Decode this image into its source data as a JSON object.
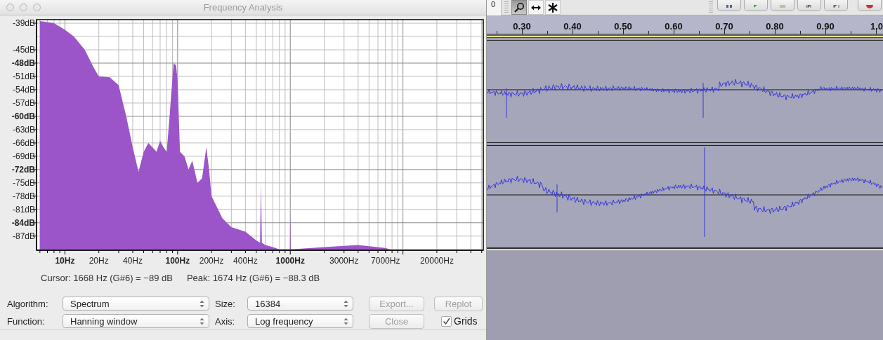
{
  "dialog": {
    "title": "Frequency Analysis",
    "spectrum_plot": {
      "x_axis_labels": [
        "10Hz",
        "20Hz",
        "40Hz",
        "100Hz",
        "200Hz",
        "400Hz",
        "1000Hz",
        "3000Hz",
        "7000Hz",
        "20000Hz"
      ],
      "y_axis_labels": [
        "-39dB",
        "-45dB",
        "-48dB",
        "-51dB",
        "-54dB",
        "-57dB",
        "-60dB",
        "-63dB",
        "-66dB",
        "-69dB",
        "-72dB",
        "-75dB",
        "-78dB",
        "-81dB",
        "-84dB",
        "-87dB"
      ]
    },
    "cursor_readout": "Cursor: 1668 Hz (G#6) = −89 dB",
    "peak_readout": "Peak: 1674 Hz (G#6) = −88.3 dB",
    "selects": [
      {
        "label": "Algorithm:",
        "value": "Spectrum"
      },
      {
        "label": "Size:",
        "value": "16384"
      },
      {
        "label": "Function:",
        "value": "Hanning window"
      },
      {
        "label": "Axis:",
        "value": "Log frequency"
      }
    ],
    "buttons": [
      {
        "label": "Export...",
        "disabled": true
      },
      {
        "label": "Replot",
        "disabled": true
      },
      {
        "label": "Close",
        "disabled": true
      }
    ],
    "grids": {
      "label": "Grids",
      "checked": true
    }
  },
  "toolbar": {
    "meter_value": "0",
    "tools": [
      {
        "kind": "zoom",
        "selected": true
      },
      {
        "kind": "timeshift",
        "selected": false
      },
      {
        "kind": "multi",
        "selected": false
      }
    ]
  },
  "ruler": {
    "labels": [
      "0.30",
      "0.40",
      "0.50",
      "0.60",
      "0.70",
      "0.80",
      "0.90",
      "1.0"
    ]
  }
}
